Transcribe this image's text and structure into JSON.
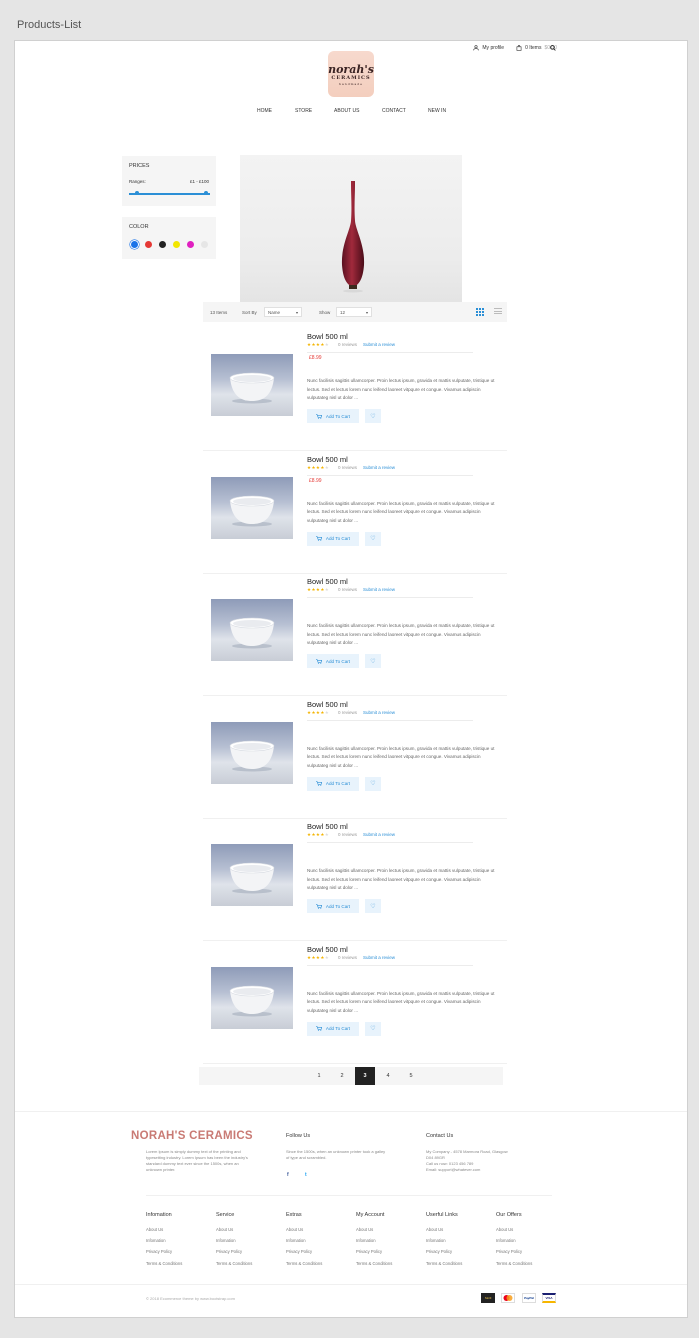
{
  "artboard": {
    "label": "Products-List"
  },
  "header": {
    "profile": "My profile",
    "cart": "0 Items",
    "cart_total": "$0.00",
    "logo": {
      "line1": "norah's",
      "line2": "CERAMICS",
      "line3": "handmade"
    },
    "nav": [
      "HOME",
      "STORE",
      "ABOUT US",
      "CONTACT",
      "NEW IN"
    ]
  },
  "filters": {
    "prices_title": "PRICES",
    "range_label": "Ranges:",
    "range_value": "£1 - £100",
    "range_min": 0.1,
    "range_max": 0.95,
    "color_title": "COLOR",
    "colors": [
      "#1a73e8",
      "#e53935",
      "#222222",
      "#f2e600",
      "#e020c0",
      "#e6e6e6"
    ],
    "selected_color": 0
  },
  "toolbar": {
    "items": "13 Items",
    "sort_label": "Sort By",
    "sort_value": "Name",
    "show_label": "Show",
    "show_value": "12"
  },
  "products": [
    {
      "name": "Bowl 500 ml",
      "rating": 4,
      "reviews": "0 reviews",
      "submit": "Submit a review",
      "price": "£8.99",
      "desc": "Nunc facilisis sagittis ullamcorper. Proin lectus ipsum, gravida et mattis vulputate, tristique ut lectus. Sed et lectus lorem nunc leifend laoreet vitpqure et congue. Vivamus adipiscin vulputateg nisl ut dolor ...",
      "cart": "Add To Cart"
    },
    {
      "name": "Bowl 500 ml",
      "rating": 4,
      "reviews": "0 reviews",
      "submit": "Submit a review",
      "price": "£8.99",
      "desc": "Nunc facilisis sagittis ullamcorper. Proin lectus ipsum, gravida et mattis vulputate, tristique ut lectus. Sed et lectus lorem nunc leifend laoreet vitpqure et congue. Vivamus adipiscin vulputateg nisl ut dolor ...",
      "cart": "Add To Cart"
    },
    {
      "name": "Bowl 500 ml",
      "rating": 4,
      "reviews": "0 reviews",
      "submit": "Submit a review",
      "price": "",
      "desc": "Nunc facilisis sagittis ullamcorper. Proin lectus ipsum, gravida et mattis vulputate, tristique ut lectus. Sed et lectus lorem nunc leifend laoreet vitpqure et congue. Vivamus adipiscin vulputateg nisl ut dolor ...",
      "cart": "Add To Cart"
    },
    {
      "name": "Bowl 500 ml",
      "rating": 4,
      "reviews": "0 reviews",
      "submit": "Submit a review",
      "price": "",
      "desc": "Nunc facilisis sagittis ullamcorper. Proin lectus ipsum, gravida et mattis vulputate, tristique ut lectus. Sed et lectus lorem nunc leifend laoreet vitpqure et congue. Vivamus adipiscin vulputateg nisl ut dolor ...",
      "cart": "Add To Cart"
    },
    {
      "name": "Bowl 500 ml",
      "rating": 4,
      "reviews": "0 reviews",
      "submit": "Submit a review",
      "price": "",
      "desc": "Nunc facilisis sagittis ullamcorper. Proin lectus ipsum, gravida et mattis vulputate, tristique ut lectus. Sed et lectus lorem nunc leifend laoreet vitpqure et congue. Vivamus adipiscin vulputateg nisl ut dolor ...",
      "cart": "Add To Cart"
    },
    {
      "name": "Bowl 500 ml",
      "rating": 4,
      "reviews": "0 reviews",
      "submit": "Submit a review",
      "price": "",
      "desc": "Nunc facilisis sagittis ullamcorper. Proin lectus ipsum, gravida et mattis vulputate, tristique ut lectus. Sed et lectus lorem nunc leifend laoreet vitpqure et congue. Vivamus adipiscin vulputateg nisl ut dolor ...",
      "cart": "Add To Cart"
    }
  ],
  "pagination": {
    "pages": [
      "1",
      "2",
      "3",
      "4",
      "5"
    ],
    "active": 2
  },
  "footer": {
    "brand": "NORAH'S CERAMICS",
    "about": "Lorem Ipsum is simply dummy text of the printing and typesetting industry. Lorem Ipsum has been the industry's standard dummy text ever since the 1500s, when an unknown printer.",
    "follow_title": "Follow Us",
    "follow_text": "Since the 1500s, when an unknown printer took a galley of type and scrambled.",
    "social": [
      "f",
      "t"
    ],
    "contact_title": "Contact Us",
    "contact_lines": [
      "My Company - 4578 Marmora Road, Glasgow",
      "D04 89GR",
      "Call us now: 0123 456 789",
      "Email: support@whatever.com"
    ],
    "columns": [
      {
        "title": "Infomation",
        "links": [
          "About Us",
          "Infomation",
          "Privacy Policy",
          "Terms & Conditions"
        ]
      },
      {
        "title": "Service",
        "links": [
          "About Us",
          "Infomation",
          "Privacy Policy",
          "Terms & Conditions"
        ]
      },
      {
        "title": "Extras",
        "links": [
          "About Us",
          "Infomation",
          "Privacy Policy",
          "Terms & Conditions"
        ]
      },
      {
        "title": "My Account",
        "links": [
          "About Us",
          "Infomation",
          "Privacy Policy",
          "Terms & Conditions"
        ]
      },
      {
        "title": "Userful Links",
        "links": [
          "About Us",
          "Infomation",
          "Privacy Policy",
          "Terms & Conditions"
        ]
      },
      {
        "title": "Our Offers",
        "links": [
          "About Us",
          "Infomation",
          "Privacy Policy",
          "Terms & Conditions"
        ]
      }
    ],
    "copyright": "© 2018 Ecommerce theme by www.bootstrap.com",
    "payments": [
      "Skrill",
      "MasterCard",
      "PayPal",
      "VISA"
    ]
  }
}
